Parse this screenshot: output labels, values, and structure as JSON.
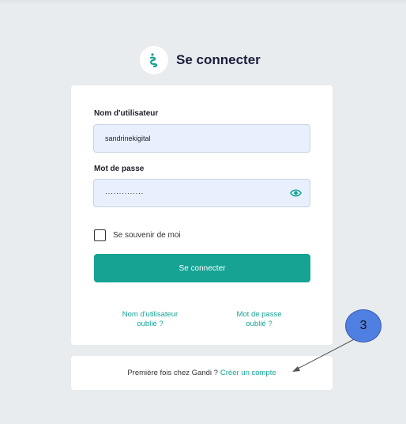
{
  "header": {
    "title": "Se connecter",
    "logo_icon": "gandi-logo-icon"
  },
  "form": {
    "username_label": "Nom d'utilisateur",
    "username_value": "sandrinekigital",
    "password_label": "Mot de passe",
    "password_value": "··············",
    "remember_label": "Se souvenir de moi",
    "submit_label": "Se connecter",
    "forgot_username_line1": "Nom d'utilisateur",
    "forgot_username_line2": "oublié ?",
    "forgot_password_line1": "Mot de passe",
    "forgot_password_line2": "oublié ?"
  },
  "signup": {
    "prefix": "Première fois chez Gandi ?",
    "link": "Créer un compte"
  },
  "annotation": {
    "number": "3"
  },
  "colors": {
    "accent": "#16a394",
    "background": "#e9ecef",
    "input_bg": "#e8effd",
    "badge": "#4f7fe0"
  }
}
